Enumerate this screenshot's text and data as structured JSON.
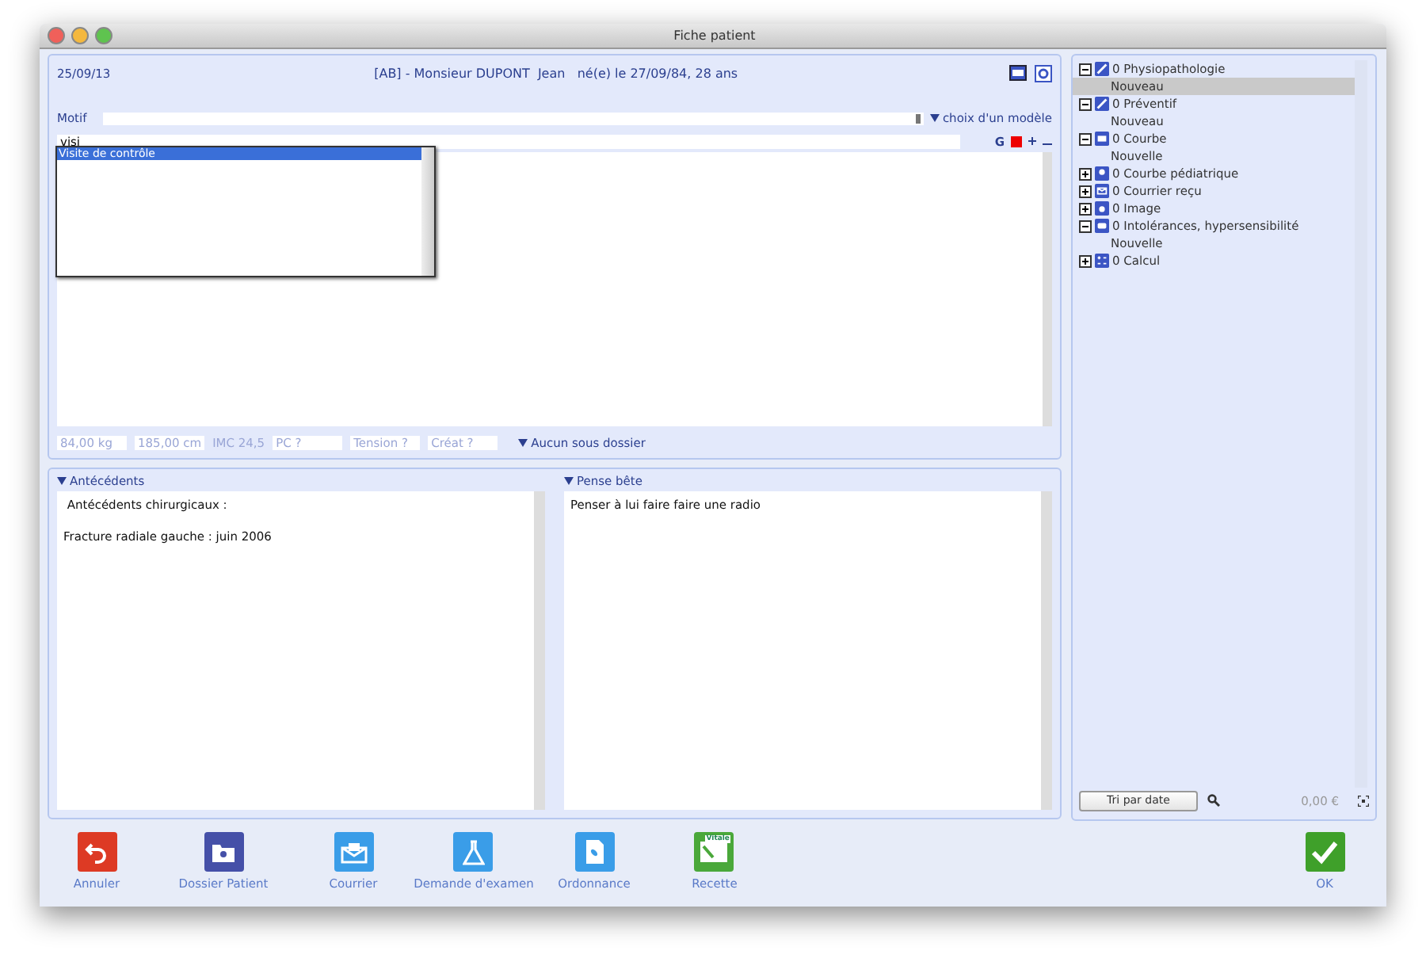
{
  "window": {
    "title": "Fiche patient"
  },
  "header": {
    "date": "25/09/13",
    "patient": "[AB] - Monsieur DUPONT  Jean   né(e) le 27/09/84, 28 ans"
  },
  "motif": {
    "label": "Motif",
    "model_menu": "choix d'un modèle"
  },
  "entry": {
    "value": "visi",
    "bold_button": "G",
    "color": "#ee0000"
  },
  "suggestions": [
    {
      "label": "Visite de contrôle",
      "selected": true
    }
  ],
  "measures": [
    {
      "kind": "field",
      "value": "84,00 kg"
    },
    {
      "kind": "field",
      "value": "185,00 cm"
    },
    {
      "kind": "text",
      "value": "IMC 24,5"
    },
    {
      "kind": "field",
      "placeholder": "PC ?"
    },
    {
      "kind": "field",
      "placeholder": "Tension ?"
    },
    {
      "kind": "field",
      "placeholder": "Créat ?"
    }
  ],
  "subfolder_menu": "Aucun sous dossier",
  "notes": [
    {
      "title": "Antécédents",
      "paragraphs": [
        " Antécédents chirurgicaux :",
        "Fracture radiale gauche : juin 2006"
      ]
    },
    {
      "title": "Pense bête",
      "paragraphs": [
        "Penser à lui faire faire une radio"
      ]
    }
  ],
  "tree": [
    {
      "label": "0 Physiopathologie",
      "kind": "pen",
      "expanded": true,
      "children": [
        {
          "label": "Nouveau",
          "selected": true
        }
      ]
    },
    {
      "label": "0 Préventif",
      "kind": "pen",
      "expanded": true,
      "children": [
        {
          "label": "Nouveau",
          "selected": false
        }
      ]
    },
    {
      "label": "0 Courbe",
      "kind": "chart",
      "expanded": true,
      "children": [
        {
          "label": "Nouvelle",
          "selected": false
        }
      ]
    },
    {
      "label": "0 Courbe pédiatrique",
      "kind": "baby",
      "expanded": false
    },
    {
      "label": "0 Courrier reçu",
      "kind": "mail",
      "expanded": false
    },
    {
      "label": "0 Image",
      "kind": "camera",
      "expanded": false
    },
    {
      "label": "0 Intolérances, hypersensibilité",
      "kind": "alert",
      "expanded": true,
      "children": [
        {
          "label": "Nouvelle",
          "selected": false
        }
      ]
    },
    {
      "label": "0 Calcul",
      "kind": "calc",
      "expanded": false
    }
  ],
  "sort_button": "Tri par date",
  "total": "0,00 €",
  "toolbar": [
    {
      "kind": "undo",
      "label": "Annuler"
    },
    {
      "kind": "folder",
      "label": "Dossier Patient"
    },
    {
      "kind": "mail",
      "label": "Courrier"
    },
    {
      "kind": "flask",
      "label": "Demande d'examen"
    },
    {
      "kind": "prescription",
      "label": "Ordonnance"
    },
    {
      "kind": "card",
      "label": "Recette",
      "badge": "Vitale"
    }
  ],
  "ok_button": {
    "kind": "check",
    "label": "OK"
  }
}
